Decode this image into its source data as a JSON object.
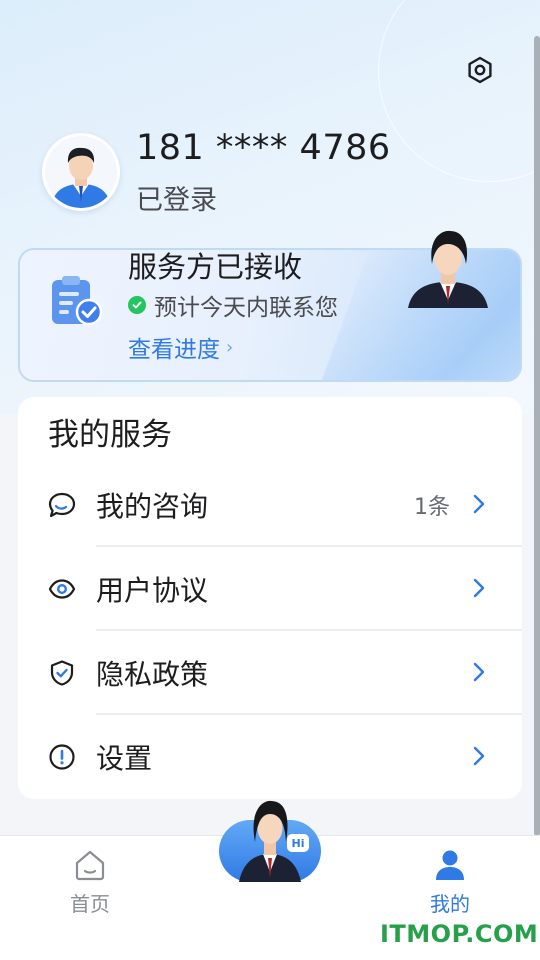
{
  "header": {
    "phone": "181 **** 4786",
    "login_status": "已登录"
  },
  "status_card": {
    "title": "服务方已接收",
    "subtitle": "预计今天内联系您",
    "link": "查看进度"
  },
  "services": {
    "title": "我的服务",
    "items": [
      {
        "label": "我的咨询",
        "meta": "1条",
        "icon": "chat-bubble-icon"
      },
      {
        "label": "用户协议",
        "meta": "",
        "icon": "eye-icon"
      },
      {
        "label": "隐私政策",
        "meta": "",
        "icon": "shield-check-icon"
      },
      {
        "label": "设置",
        "meta": "",
        "icon": "info-circle-icon"
      }
    ]
  },
  "tabbar": {
    "home_label": "首页",
    "mine_label": "我的",
    "active": "mine",
    "fab_badge": "Hi"
  },
  "watermark": "ITMOP.COM",
  "colors": {
    "accent": "#2f7ae5",
    "success": "#22c55e",
    "watermark": "#27a04a"
  }
}
